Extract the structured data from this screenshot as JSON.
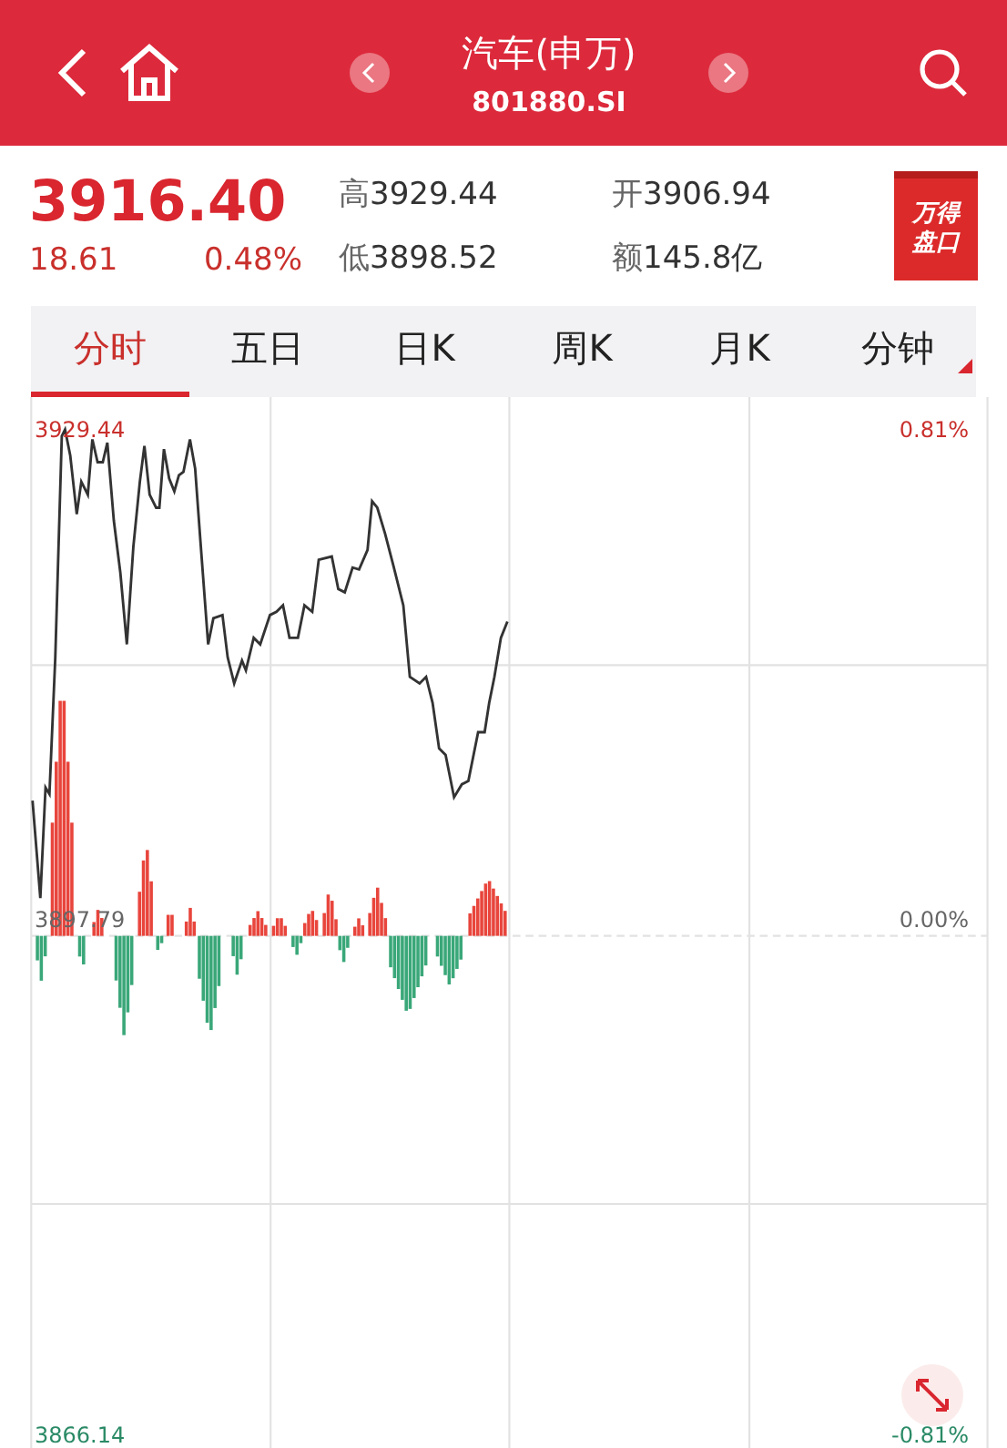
{
  "header": {
    "title": "汽车(申万)",
    "code": "801880.SI"
  },
  "quote": {
    "price": "3916.40",
    "change": "18.61",
    "change_pct": "0.48%"
  },
  "stats": [
    {
      "label": "高",
      "value": "3929.44"
    },
    {
      "label": "开",
      "value": "3906.94"
    },
    {
      "label": "低",
      "value": "3898.52"
    },
    {
      "label": "额",
      "value": "145.8亿"
    }
  ],
  "badge": {
    "line_1": "万得",
    "line_2": "盘口"
  },
  "tabs": [
    {
      "label": "分时",
      "selected": true
    },
    {
      "label": "五日",
      "selected": false
    },
    {
      "label": "日K",
      "selected": false
    },
    {
      "label": "周K",
      "selected": false
    },
    {
      "label": "月K",
      "selected": false
    },
    {
      "label": "分钟",
      "selected": false
    }
  ],
  "chart": {
    "price_high": "3929.44",
    "price_mid": "3897.79",
    "price_low": "3866.14",
    "pct_high": "0.81%",
    "pct_mid": "0.00%",
    "pct_low": "-0.81%"
  }
}
